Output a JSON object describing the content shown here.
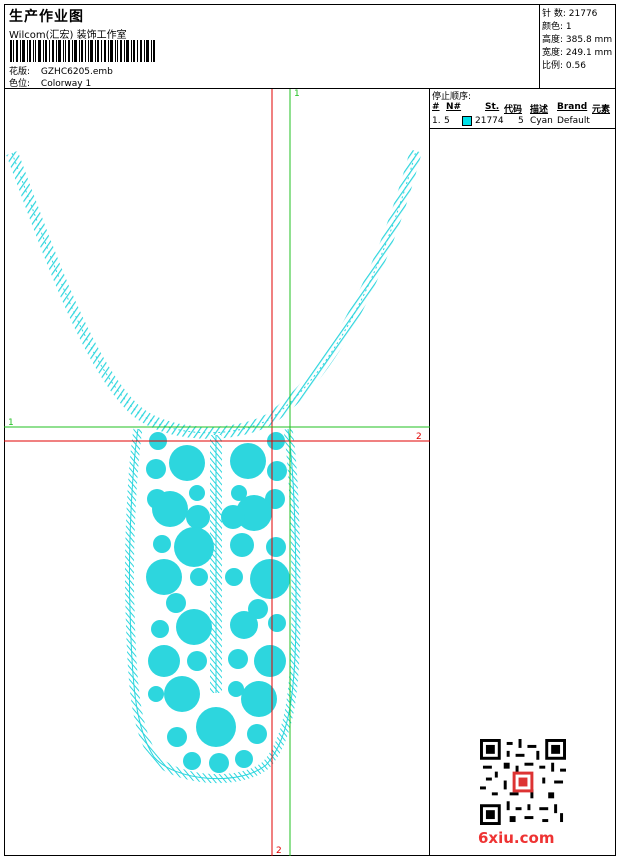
{
  "header": {
    "title": "生产作业图",
    "company": "Wilcom(汇宏) 装饰工作室",
    "design_label": "花版:",
    "design_value": "GZHC6205.emb",
    "colorway_label": "色位:",
    "colorway_value": "Colorway 1"
  },
  "stats": {
    "stitches_label": "针 数:",
    "stitches_value": "21776",
    "colors_label": "颜色:",
    "colors_value": "1",
    "height_label": "高度:",
    "height_value": "385.8 mm",
    "width_label": "宽度:",
    "width_value": "249.1 mm",
    "scale_label": "比例:",
    "scale_value": "0.56"
  },
  "stop_sequence": {
    "title": "停止顺序:",
    "columns": [
      "#",
      "N#",
      "St.",
      "代码",
      "描述",
      "Brand",
      "元素"
    ],
    "rows": [
      {
        "num": "1.",
        "n": "5",
        "color": "#00e0e8",
        "stitches": "21774",
        "code": "5",
        "desc": "Cyan",
        "brand": "Default",
        "element": ""
      }
    ]
  },
  "axes": {
    "green_vertical": "1",
    "green_horizontal": "1",
    "red_horizontal": "2",
    "red_vertical": "2"
  },
  "colors": {
    "thread": "#2dd6de",
    "red_axis": "#e00000",
    "green_axis": "#22c022"
  },
  "watermark": "6xiu.com"
}
